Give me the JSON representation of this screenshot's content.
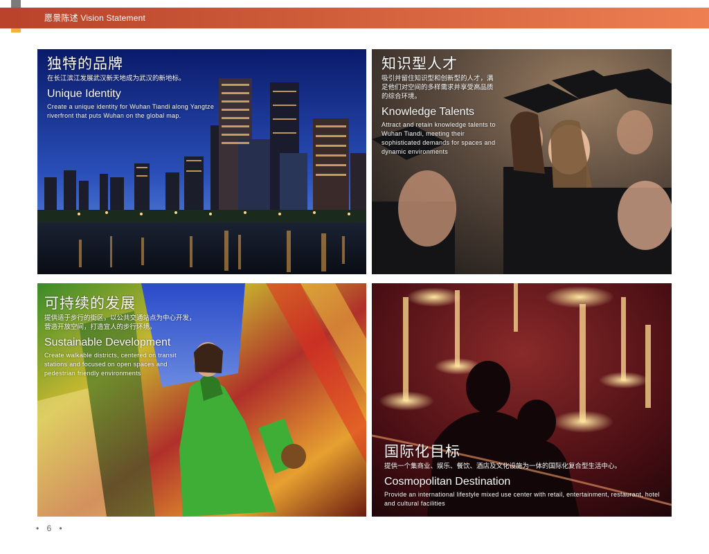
{
  "header": {
    "title": "愿景陈述  Vision Statement"
  },
  "panels": [
    {
      "cn_title": "独特的品牌",
      "cn_text": "在长江滨江发展武汉新天地成为武汉的新地标。",
      "en_title": "Unique Identity",
      "en_text": "Create a unique identity for Wuhan Tiandi along Yangtze riverfront that puts Wuhan on the global map."
    },
    {
      "cn_title": "知识型人才",
      "cn_text": "吸引并留住知识型和创新型的人才，满足他们对空间的多样需求并享受高品质的综合环境。",
      "en_title": "Knowledge Talents",
      "en_text": "Attract and retain knowledge talents to Wuhan Tiandi, meeting their sophisticated demands for spaces and dynamic environments"
    },
    {
      "cn_title": "可持续的发展",
      "cn_text": "提供适于步行的街区，以公共交通站点为中心开发，营造开放空间，打造宜人的步行环境。",
      "en_title": "Sustainable Development",
      "en_text": "Create walkable districts, centered on transit stations and focused on open spaces and pedestrian friendly environments"
    },
    {
      "cn_title": "国际化目标",
      "cn_text": "提供一个集商业、娱乐、餐饮、酒店及文化设施为一体的国际化复合型生活中心。",
      "en_title": "Cosmopolitan Destination",
      "en_text": "Provide an international lifestyle mixed use center with retail, entertainment, restaurant, hotel and cultural facilities"
    }
  ],
  "footer": {
    "page_number": "• 6 •"
  }
}
